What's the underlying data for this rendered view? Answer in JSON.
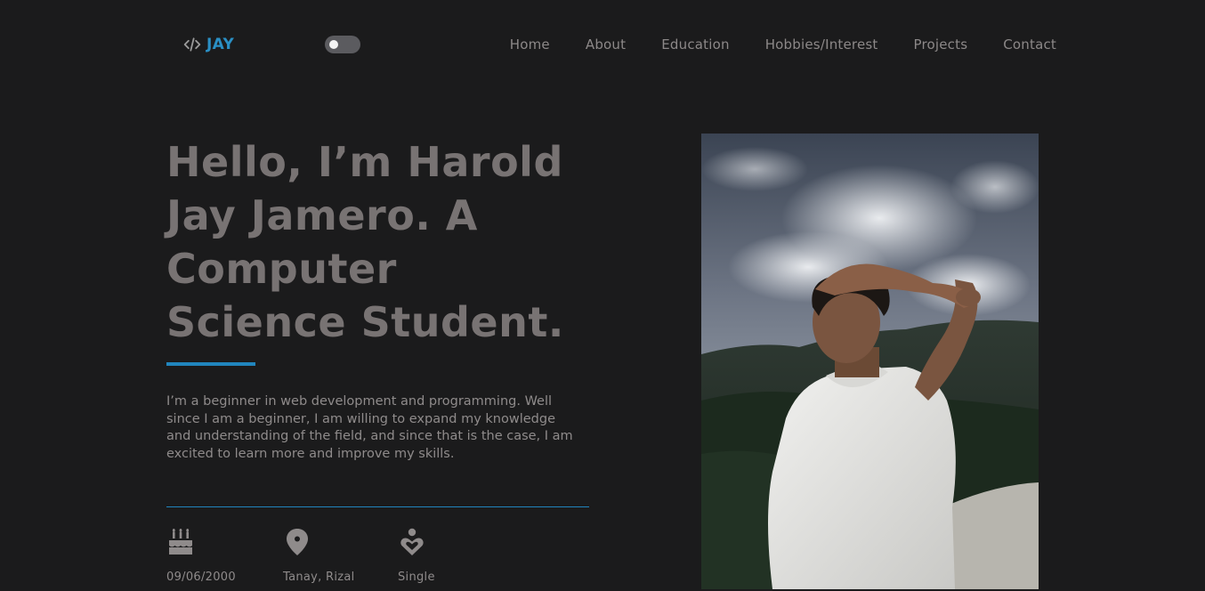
{
  "brand": {
    "icon": "code-icon",
    "name": "JAY",
    "color": "#2a8fc4"
  },
  "theme_toggle": {
    "state": "off"
  },
  "nav": {
    "links": [
      {
        "label": "Home"
      },
      {
        "label": "About"
      },
      {
        "label": "Education"
      },
      {
        "label": "Hobbies/Interest"
      },
      {
        "label": "Projects"
      },
      {
        "label": "Contact"
      }
    ]
  },
  "hero": {
    "title": "Hello, I’m Harold Jay Jamero. A Computer Science Student.",
    "intro": "I’m a beginner in web development and programming. Well since I am a beginner, I am willing to expand my knowledge and understanding of the field, and since that is the case, I am excited to learn more and improve my skills."
  },
  "info": {
    "birthday": {
      "icon": "birthday-cake-icon",
      "text": "09/06/2000"
    },
    "location": {
      "icon": "location-pin-icon",
      "text": "Tanay, Rizal"
    },
    "status": {
      "icon": "heart-person-icon",
      "text": "Single"
    }
  },
  "colors": {
    "background": "#1b1b1c",
    "accent": "#2185bd",
    "text": "#8a8686",
    "heading": "#787373"
  }
}
